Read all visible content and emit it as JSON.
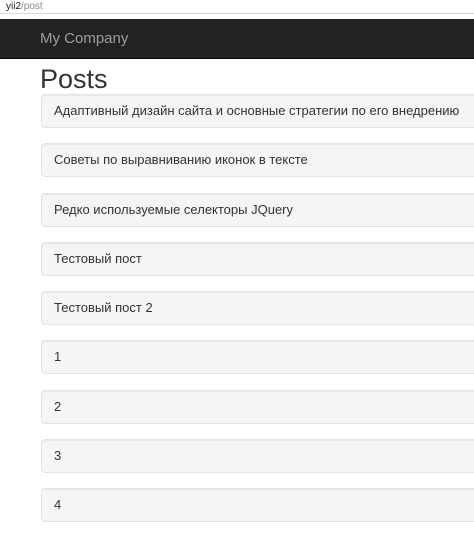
{
  "browser": {
    "host": "yii2",
    "path": "/post"
  },
  "navbar": {
    "brand": "My Company"
  },
  "page": {
    "title": "Posts"
  },
  "posts": [
    {
      "title": "Адаптивный дизайн сайта и основные стратегии по его внедрению"
    },
    {
      "title": "Советы по выравниванию иконок в тексте"
    },
    {
      "title": "Редко используемые селекторы JQuery"
    },
    {
      "title": "Тестовый пост"
    },
    {
      "title": "Тестовый пост 2"
    },
    {
      "title": "1"
    },
    {
      "title": "2"
    },
    {
      "title": "3"
    },
    {
      "title": "4"
    }
  ]
}
